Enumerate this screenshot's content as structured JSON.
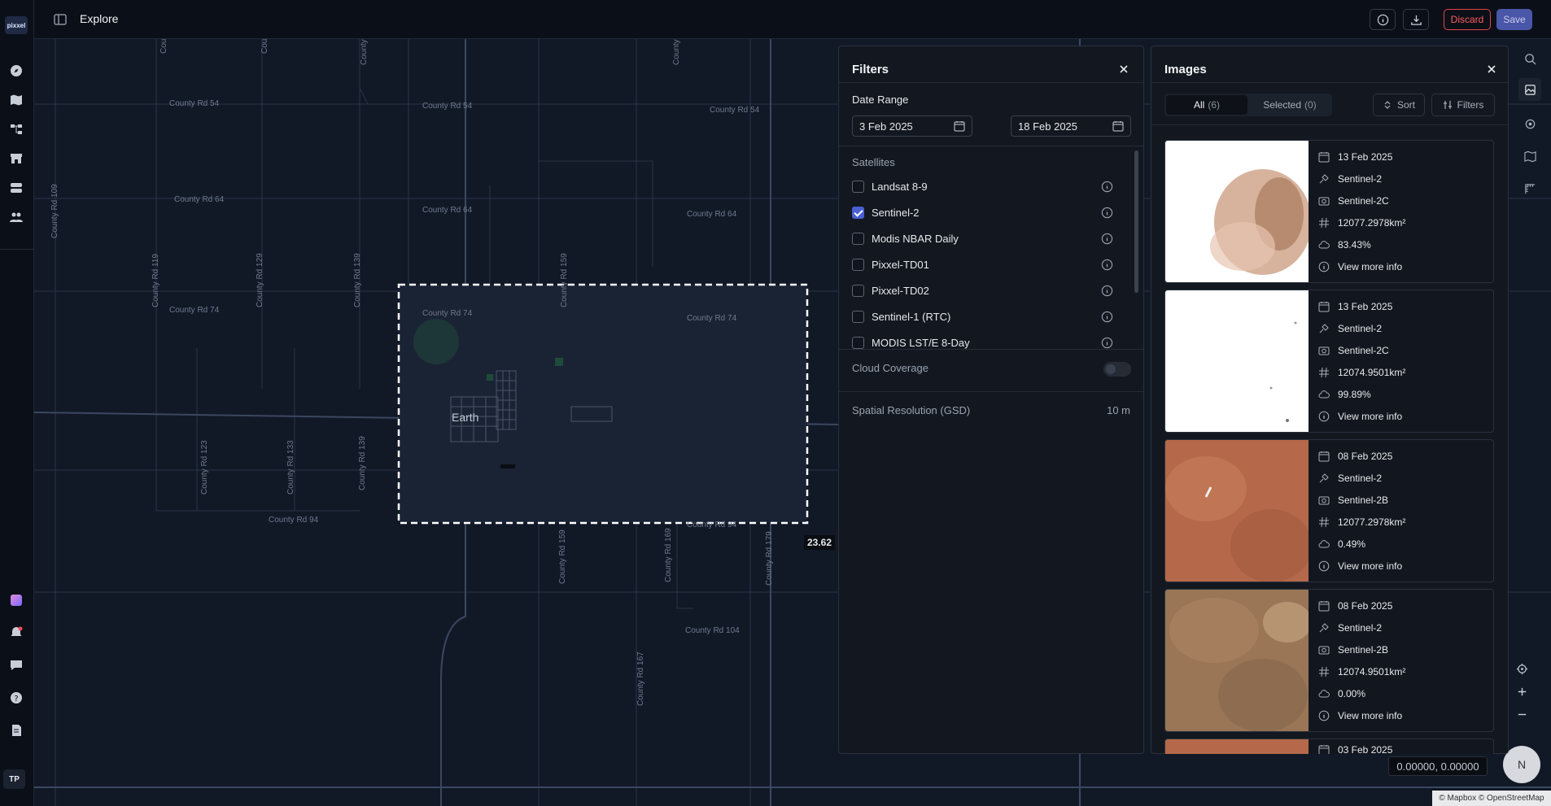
{
  "app": {
    "logo_text": "pixxel",
    "page_title": "Explore",
    "user_initials": "TP"
  },
  "header": {
    "discard_label": "Discard",
    "save_label": "Save"
  },
  "map": {
    "labels": [
      "County Rd 54",
      "County Rd 54",
      "County Rd 54",
      "County Rd 64",
      "County Rd 64",
      "County Rd 64",
      "County Rd 74",
      "County Rd 74",
      "County Rd 74",
      "County Rd 94",
      "County Rd 94",
      "County Rd 104",
      "County Rd 109",
      "County Rd 119",
      "County Rd 129",
      "County Rd 139",
      "County Rd 123",
      "County Rd 133",
      "County Rd 139",
      "County Rd 159",
      "County Rd 159",
      "County Rd 169",
      "County Rd 179",
      "County Rd 167",
      "County",
      "County",
      "County",
      "County"
    ],
    "place_label": "Earth",
    "measure_label": "23.62",
    "coordinates": "0.00000, 0.00000",
    "compass_label": "N",
    "attribution": "© Mapbox © OpenStreetMap"
  },
  "filters": {
    "title": "Filters",
    "date_range_label": "Date Range",
    "date_from": "3 Feb 2025",
    "date_to": "18 Feb 2025",
    "satellites_label": "Satellites",
    "satellites": [
      {
        "name": "Landsat 8-9",
        "checked": false
      },
      {
        "name": "Sentinel-2",
        "checked": true
      },
      {
        "name": "Modis NBAR Daily",
        "checked": false
      },
      {
        "name": "Pixxel-TD01",
        "checked": false
      },
      {
        "name": "Pixxel-TD02",
        "checked": false
      },
      {
        "name": "Sentinel-1 (RTC)",
        "checked": false
      },
      {
        "name": "MODIS LST/E 8-Day",
        "checked": false
      }
    ],
    "cloud_coverage_label": "Cloud Coverage",
    "spatial_resolution_label": "Spatial Resolution (GSD)",
    "spatial_resolution_value": "10 m"
  },
  "images": {
    "title": "Images",
    "tab_all_label": "All",
    "tab_all_count": "(6)",
    "tab_selected_label": "Selected",
    "tab_selected_count": "(0)",
    "sort_label": "Sort",
    "filters_label": "Filters",
    "cards": [
      {
        "date": "13 Feb 2025",
        "satellite": "Sentinel-2",
        "sensor": "Sentinel-2C",
        "area": "12077.2978km²",
        "cloud": "83.43%",
        "more": "View more info",
        "thumb": "cloud-heavy"
      },
      {
        "date": "13 Feb 2025",
        "satellite": "Sentinel-2",
        "sensor": "Sentinel-2C",
        "area": "12074.9501km²",
        "cloud": "99.89%",
        "more": "View more info",
        "thumb": "white"
      },
      {
        "date": "08 Feb 2025",
        "satellite": "Sentinel-2",
        "sensor": "Sentinel-2B",
        "area": "12077.2978km²",
        "cloud": "0.49%",
        "more": "View more info",
        "thumb": "terrain-red"
      },
      {
        "date": "08 Feb 2025",
        "satellite": "Sentinel-2",
        "sensor": "Sentinel-2B",
        "area": "12074.9501km²",
        "cloud": "0.00%",
        "more": "View more info",
        "thumb": "terrain-brown"
      },
      {
        "date": "03 Feb 2025",
        "thumb": "terrain-red"
      }
    ]
  },
  "colors": {
    "accent": "#4a5fd3",
    "danger": "#ff5a60",
    "save": "#4a56a8",
    "map_bg": "#111927",
    "aoi_fill": "#1a2334"
  }
}
